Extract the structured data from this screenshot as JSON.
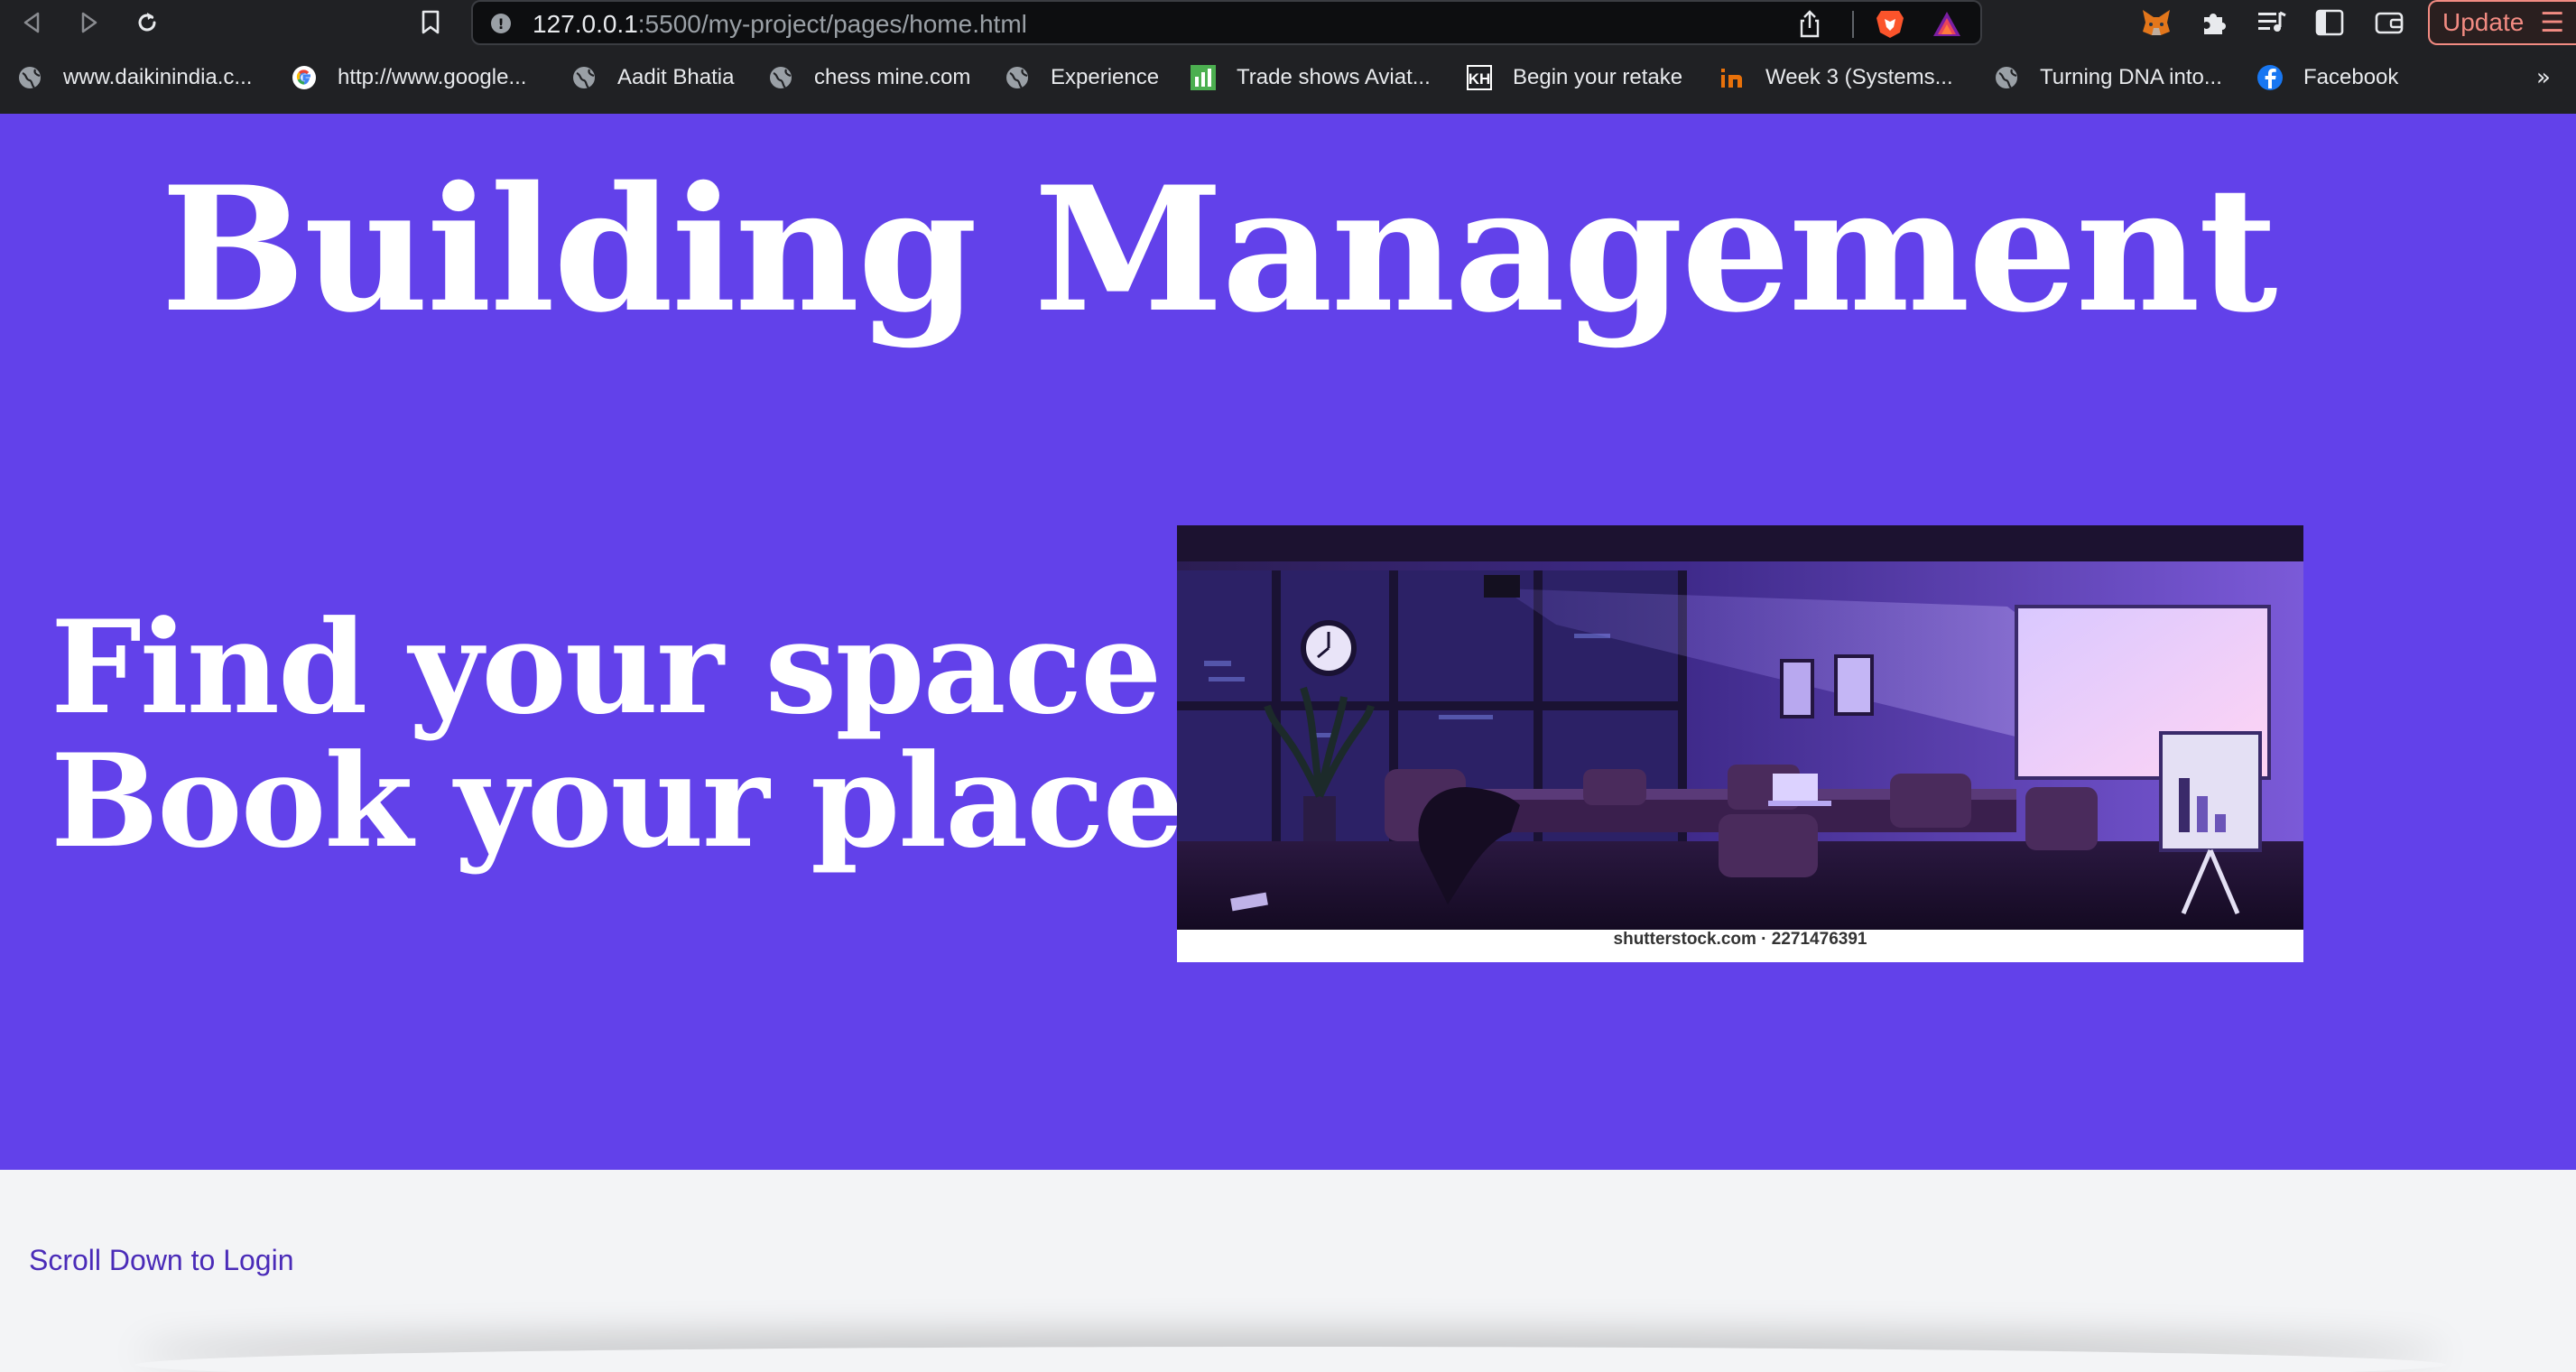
{
  "browser": {
    "url_host": "127.0.0.1",
    "url_path": ":5500/my-project/pages/home.html",
    "update_label": "Update",
    "bookmarks": [
      {
        "label": "www.daikinindia.c...",
        "icon": "globe-icon"
      },
      {
        "label": "http://www.google...",
        "icon": "google-icon"
      },
      {
        "label": "Aadit Bhatia",
        "icon": "globe-icon"
      },
      {
        "label": "chess mine.com",
        "icon": "globe-icon"
      },
      {
        "label": "Experience",
        "icon": "globe-icon"
      },
      {
        "label": "Trade shows Aviat...",
        "icon": "chart-icon"
      },
      {
        "label": "Begin your retake",
        "icon": "kh-icon"
      },
      {
        "label": "Week 3 (Systems...",
        "icon": "in-icon"
      },
      {
        "label": "Turning DNA into...",
        "icon": "globe-icon"
      },
      {
        "label": "Facebook",
        "icon": "facebook-icon"
      }
    ],
    "overflow_label": "»"
  },
  "page": {
    "title": "Building Management",
    "tagline_line1": "Find your space",
    "tagline_line2": "Book your place",
    "image_caption": "shutterstock.com · 2271476391",
    "scroll_link": "Scroll Down to Login"
  },
  "colors": {
    "hero_background": "#6241ea",
    "page_background": "#f3f4f6",
    "link_color": "#4a2bb8"
  }
}
